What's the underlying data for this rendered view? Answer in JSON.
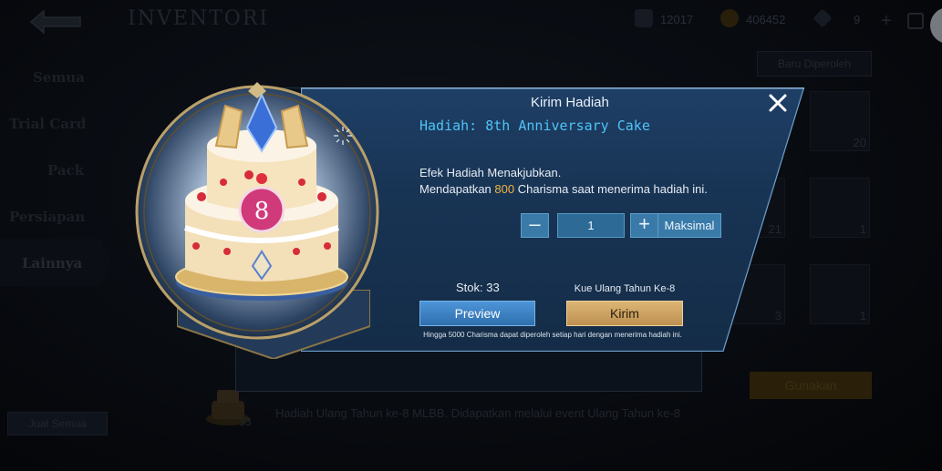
{
  "background": {
    "title": "INVENTORI",
    "currencies": [
      {
        "icon": "ticket-icon",
        "value": "12017"
      },
      {
        "icon": "battle-point-icon",
        "value": "406452"
      },
      {
        "icon": "diamond-icon",
        "value": "9"
      }
    ],
    "sidebar": [
      "Semua",
      "Trial Card",
      "Pack",
      "Persiapan",
      "Lainnya"
    ],
    "active_tab": "Lainnya",
    "sell_all": "Jual Semua",
    "filter": "Baru Diperoleh",
    "slot_counts": [
      "20",
      "21",
      "1",
      "3",
      "1"
    ],
    "use_button": "Gunakan",
    "item_description": "Hadiah Ulang Tahun ke-8 MLBB. Didapatkan melalui event Ulang Tahun ke-8",
    "cake_count": "33"
  },
  "dialog": {
    "title": "Kirim Hadiah",
    "item_name": "Hadiah: 8th Anniversary Cake",
    "effect_line1": "Efek Hadiah Menakjubkan.",
    "effect_prefix": "Mendapatkan",
    "charisma_amount": "800",
    "effect_suffix": "Charisma saat menerima hadiah ini.",
    "quantity": "1",
    "max_label": "Maksimal",
    "stock": "Stok: 33",
    "recipient": "Kue Ulang Tahun Ke-8",
    "preview_label": "Preview",
    "send_label": "Kirim",
    "note": "Hingga 5000 Charisma dapat diperoleh setiap hari dengan menerima hadiah ini."
  },
  "colors": {
    "dialog_bg": "#1a3758",
    "item_name": "#4fc3f7",
    "charisma": "#f0b441",
    "preview": "#3f86c8",
    "send": "#cfa462"
  }
}
